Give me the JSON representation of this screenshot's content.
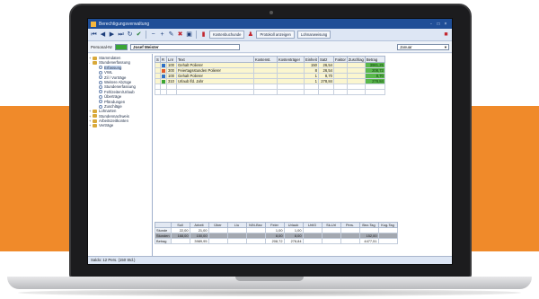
{
  "window": {
    "title": "Berechtigungsverwaltung",
    "controls": [
      "-",
      "□",
      "×"
    ]
  },
  "toolbar": {
    "kostenbuchungen_label": "Kostenbuchunde",
    "protokoll_label": "Protokoll anzeigen",
    "lohnanweisung_label": "Lohnanweisung"
  },
  "filter": {
    "personal_label": "Personal-Nr",
    "employee_name": "Josef Meister",
    "month": "Januar"
  },
  "tree": {
    "items": [
      {
        "label": "Stammdaten",
        "level": 0,
        "expand": "+",
        "folder": true
      },
      {
        "label": "Stundenerfassung",
        "level": 0,
        "expand": "-",
        "folder": true
      },
      {
        "label": "Erfassung",
        "level": 1,
        "expand": "",
        "folder": false,
        "selected": true
      },
      {
        "label": "VWL",
        "level": 1,
        "expand": "",
        "folder": false
      },
      {
        "label": "Zil / Vorträge",
        "level": 1,
        "expand": "",
        "folder": false
      },
      {
        "label": "Weitere Abzüge",
        "level": 1,
        "expand": "",
        "folder": false
      },
      {
        "label": "Stundenerfassung",
        "level": 1,
        "expand": "",
        "folder": false
      },
      {
        "label": "Fehlzeiten/Urlaub",
        "level": 1,
        "expand": "",
        "folder": false
      },
      {
        "label": "Überträge",
        "level": 1,
        "expand": "",
        "folder": false
      },
      {
        "label": "Pfändungen",
        "level": 1,
        "expand": "",
        "folder": false
      },
      {
        "label": "Zuschläge",
        "level": 1,
        "expand": "",
        "folder": false
      },
      {
        "label": "Lohnarten",
        "level": 0,
        "expand": "+",
        "folder": true
      },
      {
        "label": "Stundennachweis",
        "level": 0,
        "expand": "+",
        "folder": true
      },
      {
        "label": "Arbeitszeitkonten",
        "level": 0,
        "expand": "+",
        "folder": true
      },
      {
        "label": "Verträge",
        "level": 0,
        "expand": "+",
        "folder": true
      }
    ]
  },
  "grid": {
    "columns": [
      "S",
      "R",
      "Lnr",
      "Text",
      "Kostenst.",
      "Kostenträger",
      "Einheit",
      "Satz",
      "Faktor",
      "Zuschlag",
      "Betrag"
    ],
    "rows": [
      {
        "color": "#2e6fc7",
        "lnr": "100",
        "text": "Gehalt Polierer",
        "einheit": "150",
        "satz": "26,54",
        "betrag": "3981,25"
      },
      {
        "color": "#e35a2a",
        "lnr": "300",
        "text": "Feiertagsstunden Polierer",
        "einheit": "8",
        "satz": "26,54",
        "betrag": "208,72"
      },
      {
        "color": "#2e6fc7",
        "lnr": "100",
        "text": "Gehalt Polierer",
        "einheit": "1",
        "satz": "8,70",
        "betrag": "8,70"
      },
      {
        "color": "#3aa635",
        "lnr": "310",
        "text": "Urlaub lfd. Jahr",
        "einheit": "1",
        "satz": "278,84",
        "betrag": "278,84"
      }
    ]
  },
  "summary": {
    "columns": [
      "Soll",
      "Arbeit",
      "Über",
      "L/u",
      "N/N-Bez",
      "Feier",
      "Urlaub",
      "Urt/G",
      "Sk-Url",
      "Pers.",
      "Bez-Tag",
      "Kug-Tag"
    ],
    "rows": [
      {
        "label": "Stunde",
        "values": [
          "22,00",
          "21,00",
          "",
          "",
          "",
          "1,00",
          "1,00",
          "",
          "",
          "",
          "",
          ""
        ]
      },
      {
        "label": "Stunden",
        "values": [
          "168,00",
          "150,00",
          "",
          "",
          "",
          "8,00",
          "8,00",
          "",
          "",
          "",
          "152,00",
          ""
        ]
      },
      {
        "label": "Betrag",
        "values": [
          "",
          "3989,95",
          "",
          "",
          "",
          "208,72",
          "278,84",
          "",
          "",
          "",
          "4477,51",
          ""
        ]
      }
    ]
  },
  "status": {
    "text": "Saldo: 12 Pers. (150 Std.)"
  }
}
